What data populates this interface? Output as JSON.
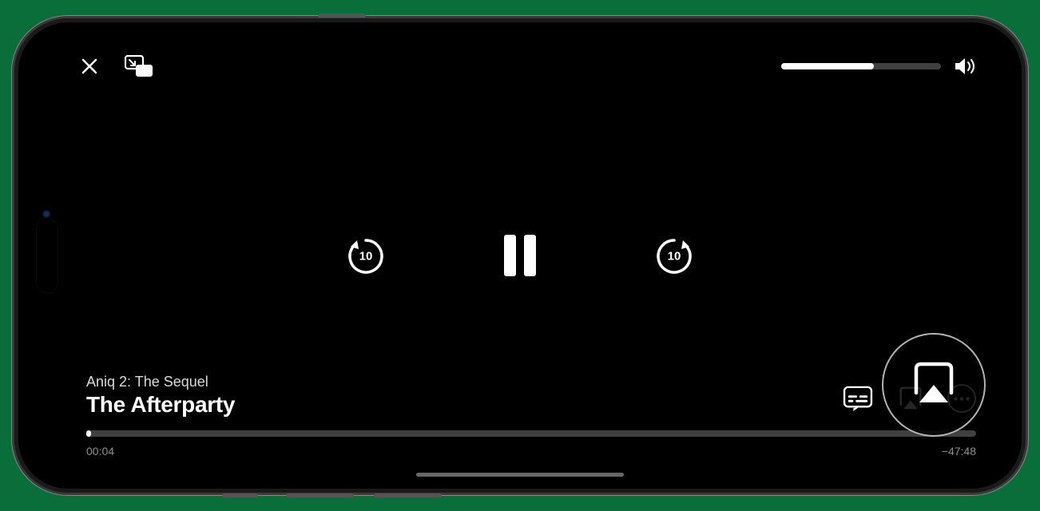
{
  "player": {
    "subtitle": "Aniq 2: The Sequel",
    "title": "The Afterparty",
    "elapsed": "00:04",
    "remaining": "−47:48",
    "progress_pct": 0.5,
    "volume_pct": 58,
    "skip_seconds": "10"
  },
  "icons": {
    "close": "close-icon",
    "pip": "picture-in-picture-icon",
    "volume": "volume-icon",
    "skip_back": "skip-back-10-icon",
    "pause": "pause-icon",
    "skip_forward": "skip-forward-10-icon",
    "subtitles": "subtitles-icon",
    "airplay": "airplay-icon",
    "more": "more-icon"
  }
}
